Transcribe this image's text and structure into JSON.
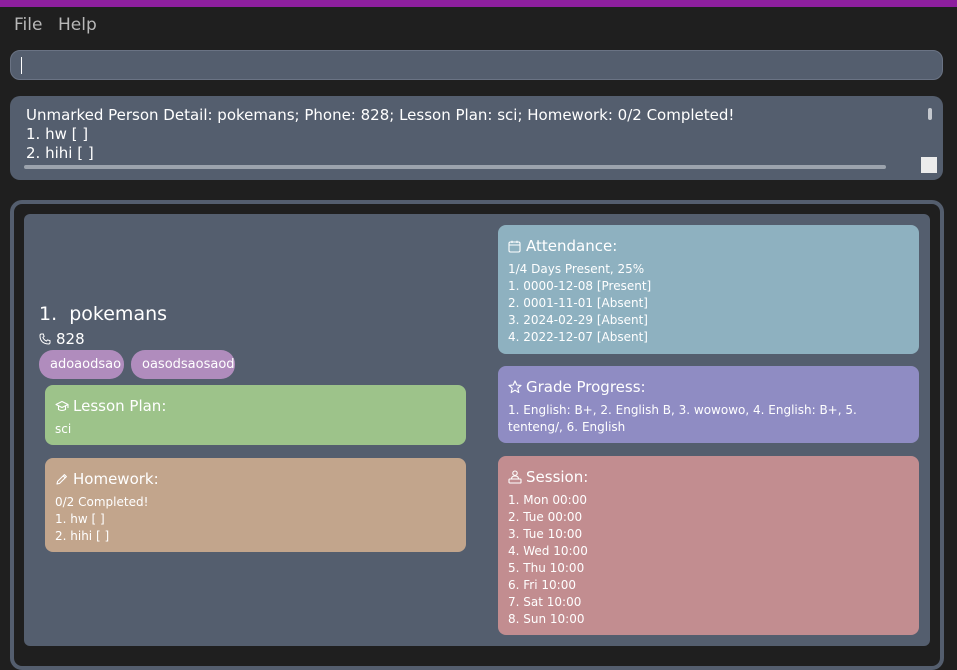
{
  "menu": {
    "file": "File",
    "help": "Help"
  },
  "command_box": {
    "value": ""
  },
  "result": {
    "lines": [
      "Unmarked Person Detail: pokemans; Phone: 828; Lesson Plan: sci; Homework: 0/2 Completed!",
      "1. hw [ ]",
      "2. hihi [ ]"
    ]
  },
  "person": {
    "index": "1.",
    "name": "pokemans",
    "phone": "828",
    "tags": [
      "adoaodsao",
      "oasodsaosaod"
    ],
    "lesson_plan": {
      "title": "Lesson Plan:",
      "value": "sci",
      "icon": "graduation-cap-icon",
      "color": "#9dc38a"
    },
    "homework": {
      "title": "Homework:",
      "summary": "0/2 Completed!",
      "items": [
        "1. hw [ ]",
        "2. hihi [ ]"
      ],
      "icon": "pencil-icon",
      "color": "#c2a58c"
    },
    "attendance": {
      "title": "Attendance:",
      "summary": "1/4 Days Present, 25%",
      "items": [
        "1. 0000-12-08 [Present]",
        "2. 0001-11-01 [Absent]",
        "3. 2024-02-29 [Absent]",
        "4. 2022-12-07 [Absent]"
      ],
      "icon": "calendar-icon",
      "color": "#8eb1c0"
    },
    "grade_progress": {
      "title": "Grade Progress:",
      "value": "1. English: B+, 2. English B, 3. wowowo, 4. English: B+, 5. tenteng/, 6. English",
      "icon": "star-icon",
      "color": "#8f8cc3"
    },
    "session": {
      "title": "Session:",
      "items": [
        "1. Mon 00:00",
        "2. Tue 00:00",
        "3. Tue 10:00",
        "4. Wed 10:00",
        "5. Thu 10:00",
        "6. Fri 10:00",
        "7. Sat 10:00",
        "8. Sun 10:00"
      ],
      "icon": "person-at-desk-icon",
      "color": "#c28d90"
    }
  },
  "colors": {
    "title_bar": "#8e1f9e",
    "background": "#1f1f1f",
    "box": "#545e6e",
    "tag": "#b08cbd"
  }
}
